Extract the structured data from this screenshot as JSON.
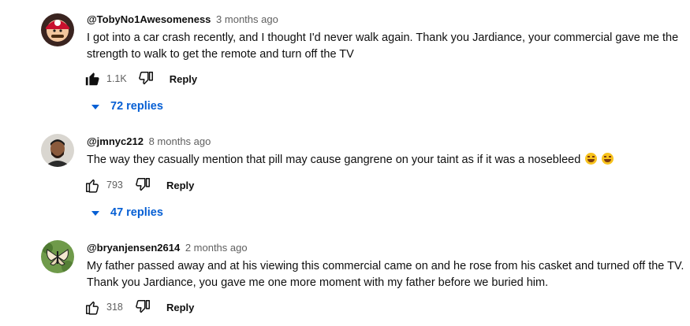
{
  "comments": [
    {
      "author": "@TobyNo1Awesomeness",
      "time": "3 months ago",
      "text": "I got into a car crash recently, and I thought I'd never walk again. Thank you Jardiance, your commercial gave me the strength to walk to get the remote and turn off the TV",
      "likes": "1.1K",
      "liked": true,
      "reply_label": "Reply",
      "replies_label": "72 replies",
      "avatar_icon": "mario-avatar"
    },
    {
      "author": "@jmnyc212",
      "time": "8 months ago",
      "text": "The way they casually mention that pill may cause gangrene on your taint as if it was a nosebleed",
      "emojis": [
        "rolling-on-floor-laughing-emoji",
        "rolling-on-floor-laughing-emoji"
      ],
      "likes": "793",
      "liked": false,
      "reply_label": "Reply",
      "replies_label": "47 replies",
      "avatar_icon": "person-avatar"
    },
    {
      "author": "@bryanjensen2614",
      "time": "2 months ago",
      "text": "My father passed away and at his viewing this commercial came on and he rose from his casket and turned off the TV. Thank you Jardiance, you gave me one more moment with my father before we buried him.",
      "likes": "318",
      "liked": false,
      "reply_label": "Reply",
      "avatar_icon": "butterfly-avatar"
    }
  ],
  "colors": {
    "link_blue": "#065fd4",
    "meta_gray": "#606060",
    "text": "#0f0f0f"
  }
}
